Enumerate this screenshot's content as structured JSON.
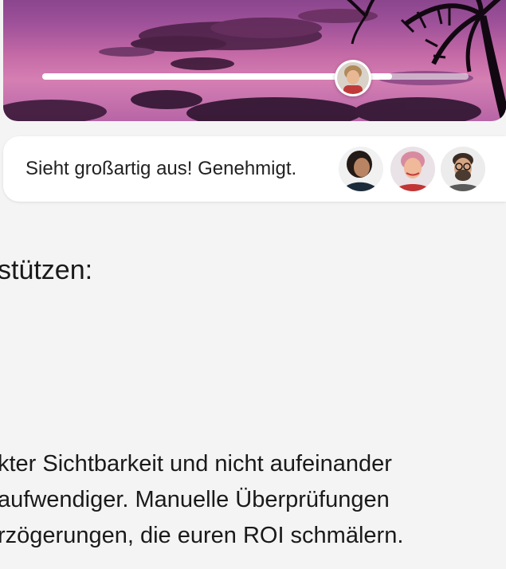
{
  "hero": {
    "image_description": "",
    "slider": {
      "progress_fraction": 0.82
    }
  },
  "comment": {
    "text": "Sieht großartig aus! Genehmigt.",
    "avatars": [
      {
        "name": "reviewer-1"
      },
      {
        "name": "reviewer-2"
      },
      {
        "name": "reviewer-3"
      }
    ]
  },
  "section": {
    "heading_fragment": "stützen:",
    "paragraph_lines": [
      "kter Sichtbarkeit und nicht aufeinander",
      "aufwendiger. Manuelle Überprüfungen",
      "rzögerungen, die euren ROI schmälern."
    ]
  },
  "colors": {
    "page_background": "#f4f4f4",
    "card_background": "#ffffff",
    "text": "#1a1a1a",
    "sky_top": "#7d3d86",
    "sky_bottom": "#d57fb3"
  }
}
